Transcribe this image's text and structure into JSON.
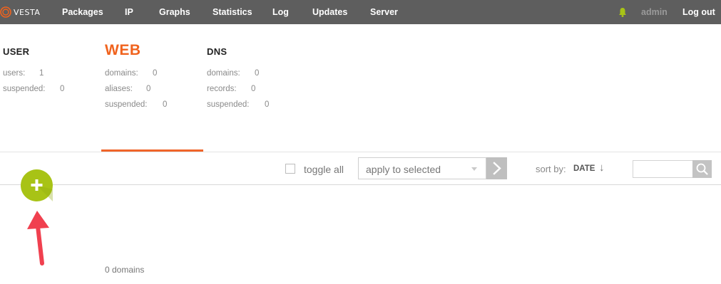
{
  "nav": {
    "logo_text": "VESTA",
    "items": [
      "Packages",
      "IP",
      "Graphs",
      "Statistics",
      "Log",
      "Updates",
      "Server"
    ],
    "user": "admin",
    "logout": "Log out"
  },
  "stats": {
    "user": {
      "title": "USER",
      "rows": [
        {
          "label": "users:",
          "value": "1"
        },
        {
          "label": "suspended:",
          "value": "0"
        }
      ]
    },
    "web": {
      "title": "WEB",
      "rows": [
        {
          "label": "domains:",
          "value": "0"
        },
        {
          "label": "aliases:",
          "value": "0"
        },
        {
          "label": "suspended:",
          "value": "0"
        }
      ]
    },
    "dns": {
      "title": "DNS",
      "rows": [
        {
          "label": "domains:",
          "value": "0"
        },
        {
          "label": "records:",
          "value": "0"
        },
        {
          "label": "suspended:",
          "value": "0"
        }
      ]
    }
  },
  "toolbar": {
    "toggle_all": "toggle all",
    "apply_select": "apply to selected",
    "sort_label": "sort by:",
    "sort_value": "DATE",
    "sort_arrow": "↓"
  },
  "footer": {
    "count": "0 domains"
  },
  "colors": {
    "topbar": "#5e5e5e",
    "accent": "#f0631e",
    "add_button": "#a8c316",
    "arrow": "#f0404f"
  }
}
